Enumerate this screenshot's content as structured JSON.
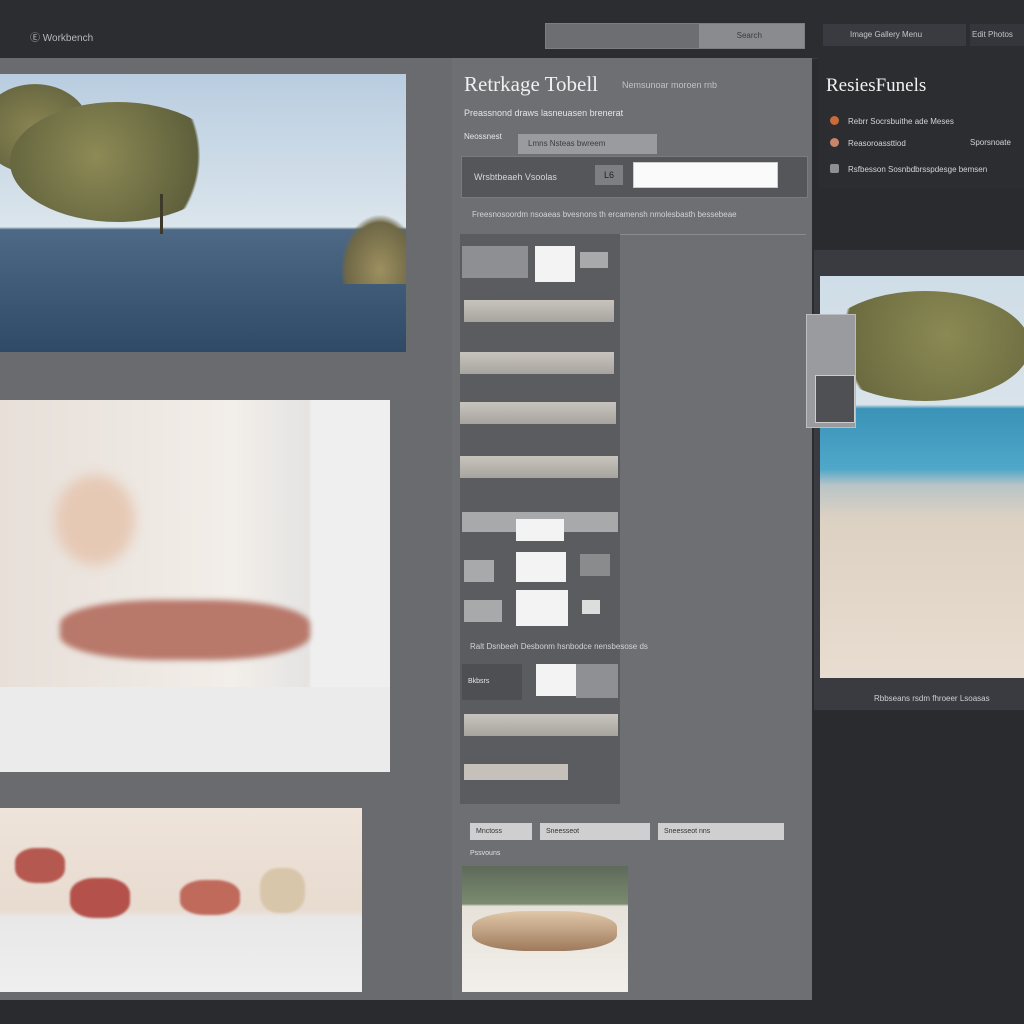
{
  "app": {
    "title": "Ⓔ Workbench"
  },
  "topbar": {
    "search_label": "Search",
    "right_button": "Image Gallery Menu",
    "right_button_2": "Edit Photos"
  },
  "panel": {
    "title": "Retrkage Tobell",
    "title_sub": "Nemsunoar moroen rnb",
    "subtitle": "Preassnond draws lasneuasen brenerat",
    "field_label": "Neossnest",
    "field_value": "Lmns Nsteas bwreem",
    "input_label": "Wrsbtbeaeh Vsoolas",
    "chip": "L6",
    "hint": "Freesnosoordm nsoaeas bvesnons th ercamensh nmolesbasth bessebeae",
    "mid_label": "Ralt Dsnbeeh Desbonm hsnbodce nensbesose ds",
    "button_label": "Bkbsrs",
    "pills": [
      "Mnctoss",
      "Sneesseot",
      "Sneesseot nns"
    ],
    "section_label": "Pssvouns"
  },
  "right_panel": {
    "title": "ResiesFunels",
    "items": [
      {
        "label": "Rebrr Socrsbuithe ade Meses",
        "right": "",
        "color": "#c96b3a"
      },
      {
        "label": "Reasoroassttiod",
        "right": "Sporsnoate",
        "color": "#c9856a"
      },
      {
        "label": "Rsfbesson Sosnbdbrsspdesge bemsen",
        "right": "",
        "color": "#8e8f92"
      }
    ],
    "caption": "Rbbseans rsdm fhroeer Lsoasas"
  }
}
